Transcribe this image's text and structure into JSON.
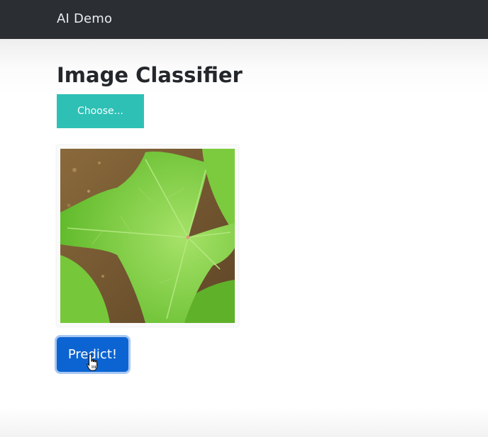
{
  "navbar": {
    "brand": "AI Demo"
  },
  "main": {
    "title": "Image Classifier",
    "choose_label": "Choose...",
    "predict_label": "Predict!",
    "preview_image": "leaf-photo"
  },
  "colors": {
    "navbar_bg": "#2b2e33",
    "choose_button": "#2fc0b5",
    "predict_button": "#0c64d2"
  },
  "icons": {
    "cursor": "hand-pointer-icon"
  }
}
